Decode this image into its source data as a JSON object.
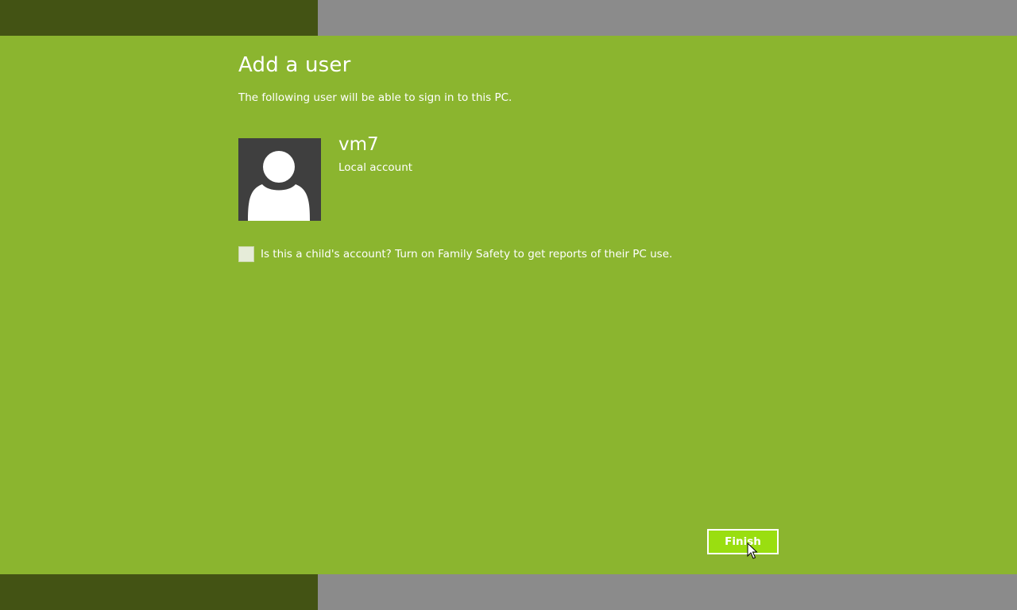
{
  "dialog": {
    "title": "Add a user",
    "subtitle": "The following user will be able to sign in to this PC."
  },
  "user": {
    "name": "vm7",
    "account_type": "Local account",
    "avatar_icon": "user-silhouette-icon"
  },
  "family_safety": {
    "checkbox_label": "Is this a child's account? Turn on Family Safety to get reports of their PC use.",
    "checked": false
  },
  "actions": {
    "finish_label": "Finish"
  },
  "colors": {
    "dialog_background": "#8bb52f",
    "side_band_dark": "#435314",
    "side_band_gray": "#8b8b8b",
    "finish_button": "#9ade10",
    "avatar_background": "#3f3f3f"
  }
}
